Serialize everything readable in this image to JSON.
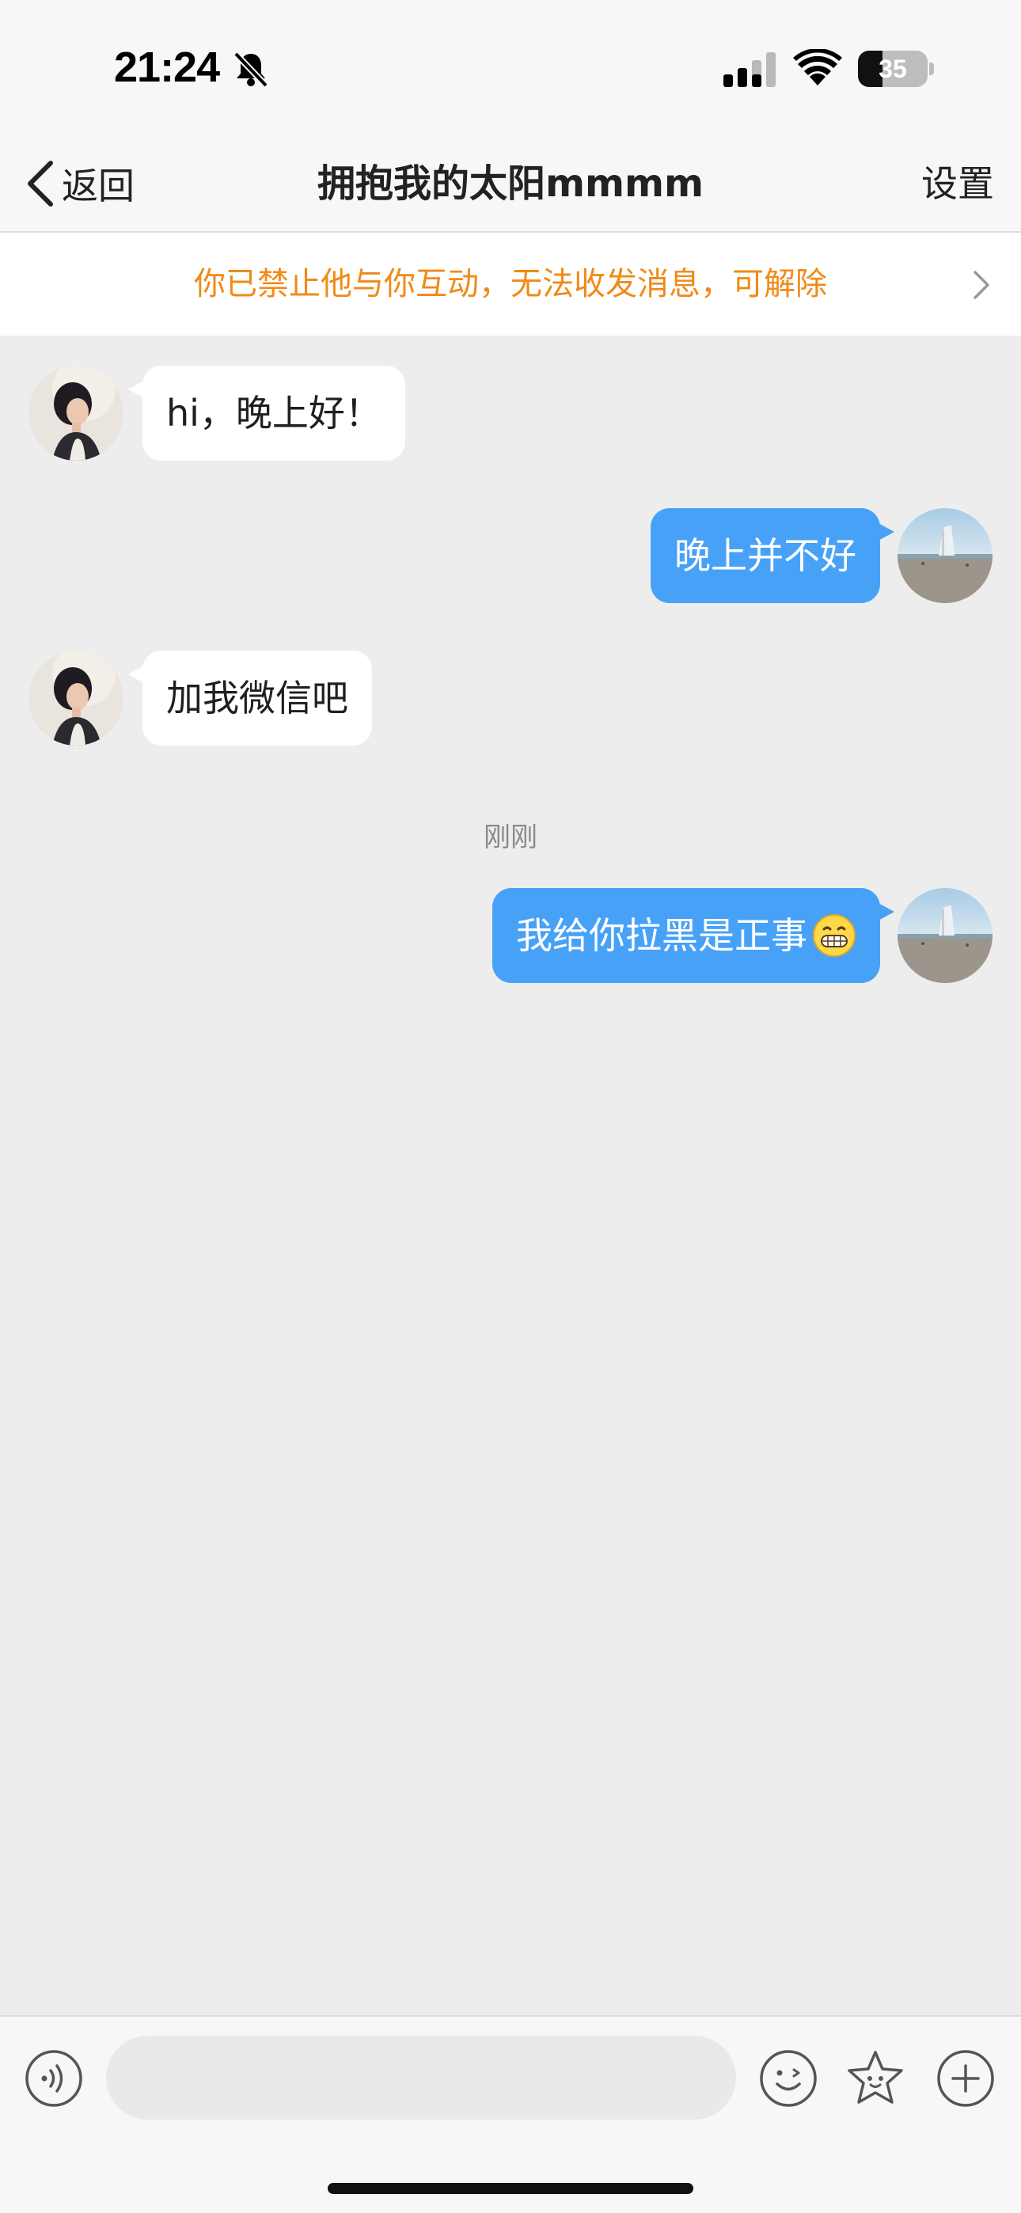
{
  "status_bar": {
    "time": "21:24",
    "battery_level": "35",
    "battery_fraction": 0.35
  },
  "nav": {
    "back_label": "返回",
    "title": "拥抱我的太阳mmmm",
    "settings_label": "设置"
  },
  "banner": {
    "text": "你已禁止他与你互动，无法收发消息，可解除"
  },
  "messages": [
    {
      "side": "in",
      "text": "hi，晚上好！"
    },
    {
      "side": "out",
      "text": "晚上并不好"
    },
    {
      "side": "in",
      "text": "加我微信吧"
    },
    {
      "side": "out",
      "text": "我给你拉黑是正事",
      "emoji": "grinning-face"
    }
  ],
  "timestamp": "刚刚",
  "input": {
    "value": "",
    "placeholder": ""
  },
  "colors": {
    "outgoing_bubble": "#47a2f7",
    "incoming_bubble": "#ffffff",
    "banner_text": "#f08a17",
    "background": "#ededed"
  },
  "icons": {
    "voice": "voice-wave-icon",
    "emoji": "smiley-icon",
    "sticker": "star-face-icon",
    "more": "plus-circle-icon"
  }
}
